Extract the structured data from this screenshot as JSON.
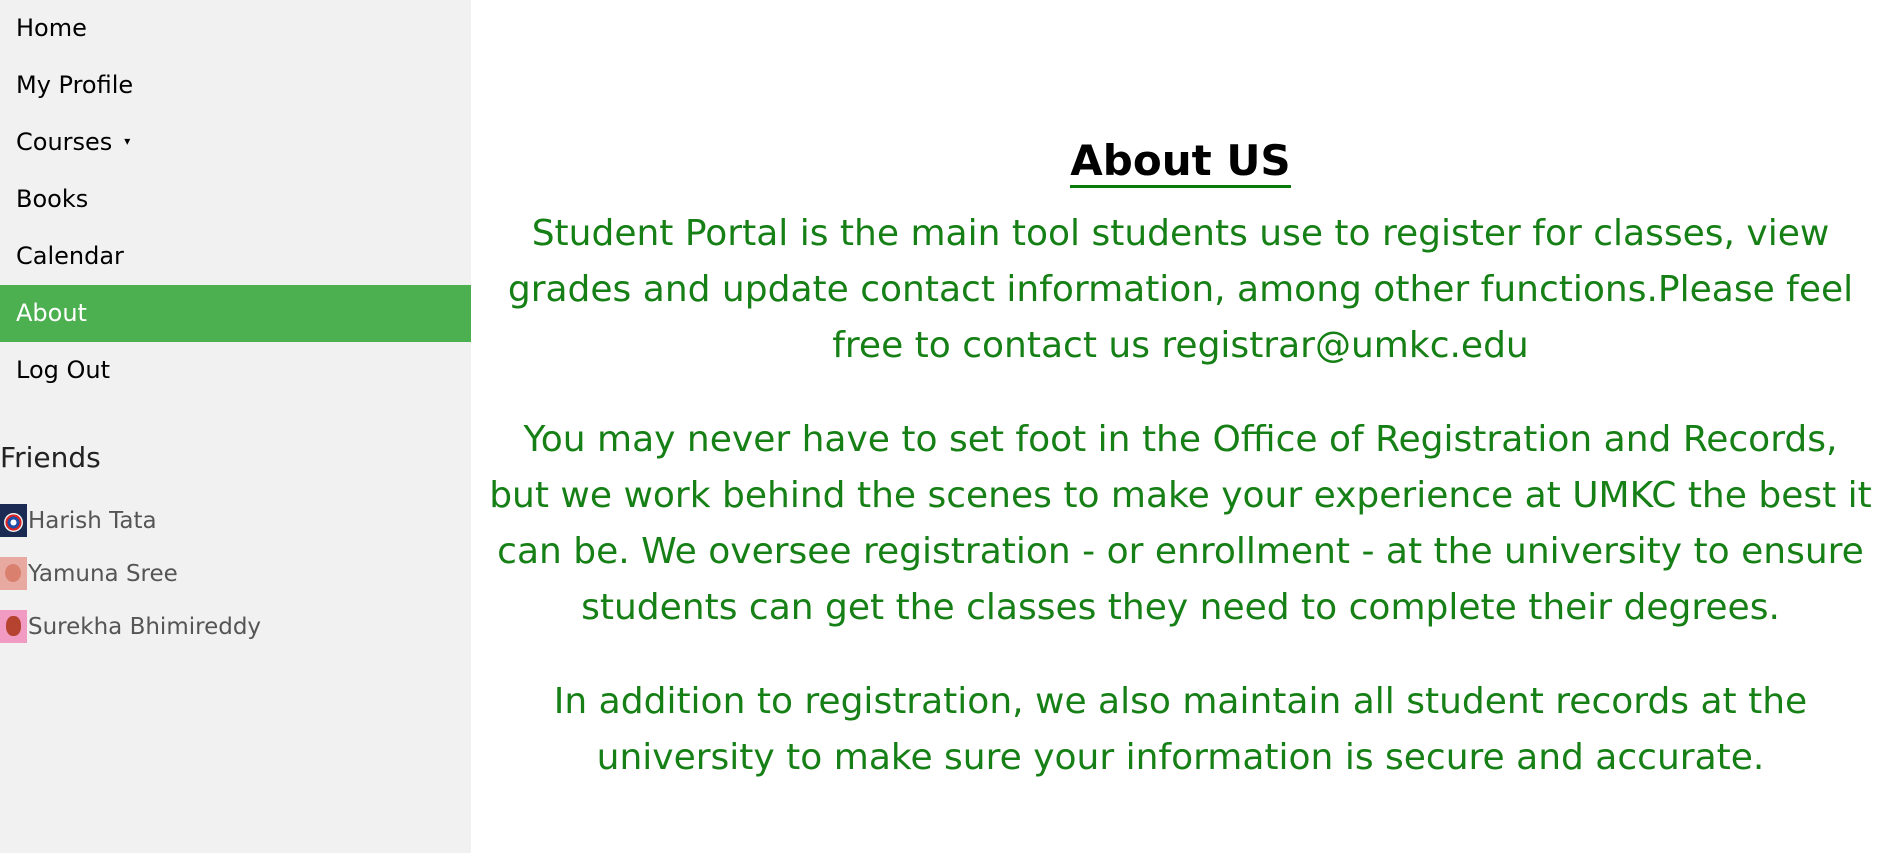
{
  "sidebar": {
    "nav": [
      {
        "label": "Home"
      },
      {
        "label": "My Profile"
      },
      {
        "label": "Courses",
        "dropdown_indicator": "▾"
      },
      {
        "label": "Books"
      },
      {
        "label": "Calendar"
      },
      {
        "label": "About",
        "active": true
      },
      {
        "label": "Log Out"
      }
    ],
    "friends_title": "Friends",
    "friends": [
      {
        "name": "Harish Tata",
        "avatar_icon": "captain-america-avatar"
      },
      {
        "name": "Yamuna Sree",
        "avatar_icon": "flower-avatar"
      },
      {
        "name": "Surekha Bhimireddy",
        "avatar_icon": "teddy-bear-avatar"
      }
    ]
  },
  "main": {
    "title": "About US",
    "paragraphs": [
      "Student Portal is the main tool students use to register for classes, view grades and update contact information, among other functions.Please feel free to contact us registrar@umkc.edu",
      "You may never have to set foot in the Office of Registration and Records, but we work behind the scenes to make your experience at UMKC the best it can be. We oversee registration - or enrollment - at the university to ensure students can get the classes they need to complete their degrees.",
      "In addition to registration, we also maintain all student records at the university to make sure your information is secure and accurate."
    ]
  },
  "colors": {
    "active_nav": "#4caf50",
    "sidebar_bg": "#f1f1f1",
    "body_text_green": "#168016"
  }
}
